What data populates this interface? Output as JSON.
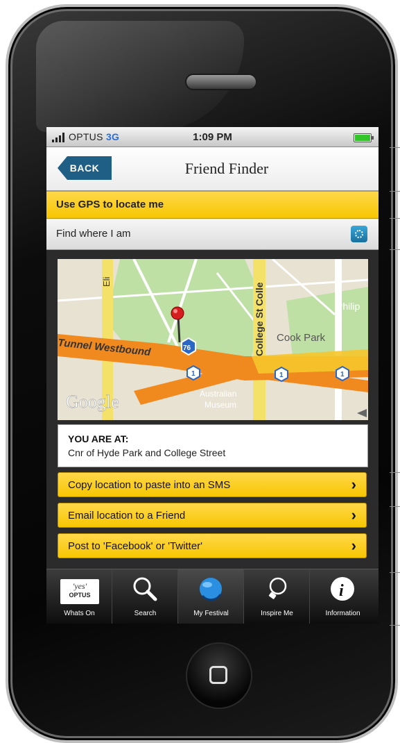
{
  "status_bar": {
    "carrier": "OPTUS",
    "network": "3G",
    "time": "1:09 PM"
  },
  "nav": {
    "back_label": "BACK",
    "title": "Friend Finder"
  },
  "gps_bar": {
    "label": "Use GPS to locate me"
  },
  "find_row": {
    "label": "Find where I am"
  },
  "map": {
    "labels": {
      "street_elizabeth": "Eli",
      "street_college": "College St Colle",
      "phillip": "Philip",
      "cook_park": "Cook Park",
      "tunnel": "Tunnel Westbound",
      "route_76": "76",
      "route_1": "1",
      "museum_line1": "Australian",
      "museum_line2": "Museum",
      "google": "Google"
    }
  },
  "location": {
    "heading": "YOU ARE AT:",
    "address": "Cnr of Hyde Park and College Street"
  },
  "actions": [
    {
      "label": "Copy location to paste into an SMS"
    },
    {
      "label": "Email location to a Friend"
    },
    {
      "label": "Post to 'Facebook' or 'Twitter'"
    }
  ],
  "tabbar": {
    "tabs": [
      {
        "label": "Whats On",
        "logo_top": "'yes'",
        "logo_bottom": "OPTUS"
      },
      {
        "label": "Search"
      },
      {
        "label": "My Festival"
      },
      {
        "label": "Inspire Me"
      },
      {
        "label": "Information"
      }
    ]
  },
  "colors": {
    "accent_yellow": "#f7c600",
    "back_blue": "#1f5f86",
    "map_road_orange": "#f08a1e"
  }
}
